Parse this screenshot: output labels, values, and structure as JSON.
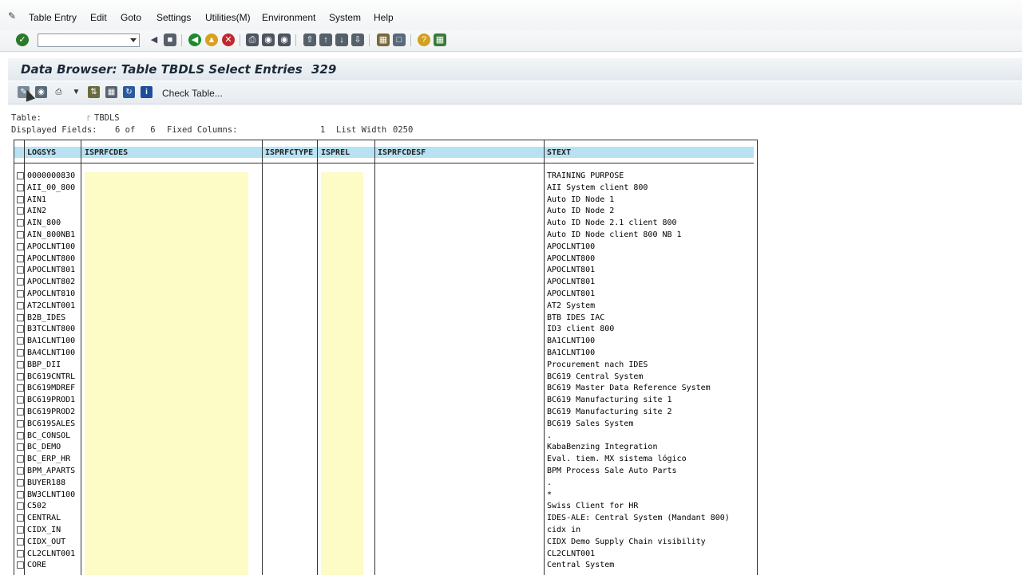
{
  "menubar": {
    "items": [
      "Table Entry",
      "Edit",
      "Goto",
      "Settings",
      "Utilities(M)",
      "Environment",
      "System",
      "Help"
    ]
  },
  "toolbar": {
    "command_field_value": "",
    "icons": [
      "enter-icon",
      "back-icon",
      "save-icon",
      "nav-back-icon",
      "exit-icon",
      "cancel-icon",
      "print-icon",
      "find-icon",
      "find-next-icon",
      "first-page-icon",
      "prev-page-icon",
      "next-page-icon",
      "last-page-icon",
      "new-session-icon",
      "shortcut-icon",
      "help-icon",
      "layout-icon"
    ]
  },
  "title": {
    "text": "Data Browser: Table TBDLS Select Entries",
    "count": "329"
  },
  "app_toolbar": {
    "check_table_label": "Check Table..."
  },
  "info": {
    "table_label": "Table:",
    "table_value": "TBDLS",
    "displayed_label": "Displayed Fields:",
    "displayed_value": "6 of   6",
    "fixed_label": "Fixed Columns:",
    "fixed_value": "1",
    "width_label": "List Width",
    "width_value": "0250"
  },
  "table": {
    "columns": [
      "LOGSYS",
      "ISPRFCDES",
      "ISPRFCTYPE",
      "ISPREL",
      "ISPRFCDESF",
      "STEXT"
    ],
    "rows": [
      {
        "logsys": "0000000830",
        "stext": "TRAINING PURPOSE"
      },
      {
        "logsys": "AII_00_800",
        "stext": "AII System client 800"
      },
      {
        "logsys": "AIN1",
        "stext": "Auto ID Node 1"
      },
      {
        "logsys": "AIN2",
        "stext": "Auto ID Node 2"
      },
      {
        "logsys": "AIN_800",
        "stext": "Auto ID Node 2.1 client 800"
      },
      {
        "logsys": "AIN_800NB1",
        "stext": "Auto ID Node client 800 NB 1"
      },
      {
        "logsys": "APOCLNT100",
        "stext": "APOCLNT100"
      },
      {
        "logsys": "APOCLNT800",
        "stext": "APOCLNT800"
      },
      {
        "logsys": "APOCLNT801",
        "stext": "APOCLNT801"
      },
      {
        "logsys": "APOCLNT802",
        "stext": "APOCLNT801"
      },
      {
        "logsys": "APOCLNT810",
        "stext": "APOCLNT801"
      },
      {
        "logsys": "AT2CLNT001",
        "stext": "AT2 System"
      },
      {
        "logsys": "B2B_IDES",
        "stext": "BTB IDES IAC"
      },
      {
        "logsys": "B3TCLNT800",
        "stext": "ID3 client  800"
      },
      {
        "logsys": "BA1CLNT100",
        "stext": "BA1CLNT100"
      },
      {
        "logsys": "BA4CLNT100",
        "stext": "BA1CLNT100"
      },
      {
        "logsys": "BBP_DII",
        "stext": "Procurement nach IDES"
      },
      {
        "logsys": "BC619CNTRL",
        "stext": "BC619 Central System"
      },
      {
        "logsys": "BC619MDREF",
        "stext": "BC619 Master Data Reference System"
      },
      {
        "logsys": "BC619PROD1",
        "stext": "BC619 Manufacturing site 1"
      },
      {
        "logsys": "BC619PROD2",
        "stext": "BC619 Manufacturing site 2"
      },
      {
        "logsys": "BC619SALES",
        "stext": "BC619 Sales System"
      },
      {
        "logsys": "BC_CONSOL",
        "stext": "."
      },
      {
        "logsys": "BC_DEMO",
        "stext": "KabaBenzing Integration"
      },
      {
        "logsys": "BC_ERP_HR",
        "stext": "Eval. tiem. MX sistema lógico"
      },
      {
        "logsys": "BPM_APARTS",
        "stext": "BPM Process Sale Auto Parts"
      },
      {
        "logsys": "BUYER188",
        "stext": "."
      },
      {
        "logsys": "BW3CLNT100",
        "stext": "*"
      },
      {
        "logsys": "C502",
        "stext": "Swiss Client for HR"
      },
      {
        "logsys": "CENTRAL",
        "stext": "IDES-ALE: Central System (Mandant 800)"
      },
      {
        "logsys": "CIDX_IN",
        "stext": "cidx in"
      },
      {
        "logsys": "CIDX_OUT",
        "stext": "CIDX Demo Supply Chain visibility"
      },
      {
        "logsys": "CL2CLNT001",
        "stext": "CL2CLNT001"
      },
      {
        "logsys": "CORE",
        "stext": "Central System"
      }
    ]
  },
  "colors": {
    "header_bg": "#b8e2f3",
    "highlight_bg": "#fdfbc6",
    "title_text": "#1b2a38"
  }
}
